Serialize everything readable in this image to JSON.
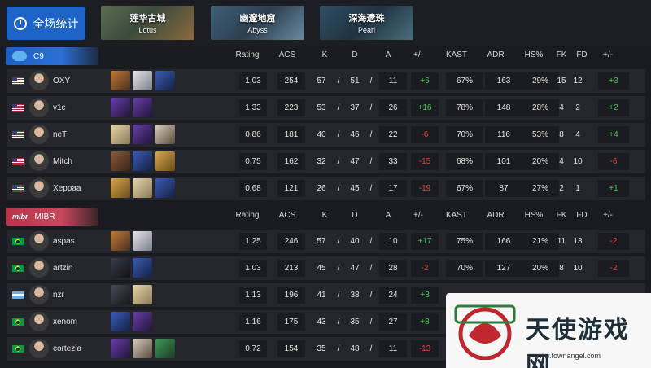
{
  "top_bar": {
    "all_stats_label": "全场统计",
    "maps": [
      {
        "cn": "莲华古城",
        "en": "Lotus"
      },
      {
        "cn": "幽邃地窟",
        "en": "Abyss"
      },
      {
        "cn": "深海遗珠",
        "en": "Pearl"
      }
    ]
  },
  "headers": [
    "Rating",
    "ACS",
    "K",
    "D",
    "A",
    "+/-",
    "KAST",
    "ADR",
    "HS%",
    "FK",
    "FD",
    "+/-"
  ],
  "colors": {
    "accent_blue": "#1e63c8",
    "team_red": "#c8485d",
    "positive": "#3fd14c",
    "negative": "#e5453b"
  },
  "teams": [
    {
      "name": "C9",
      "logo_icon": "cloud9-logo-icon",
      "players": [
        {
          "flag": "us",
          "name": "OXY",
          "agents": [
            "orange-agent-icon",
            "white-agent-icon",
            "blue-agent-icon"
          ],
          "rating": "1.03",
          "acs": "254",
          "k": "57",
          "sep1": "/",
          "d": "51",
          "sep2": "/",
          "a": "11",
          "pm": "+6",
          "kast": "67%",
          "adr": "163",
          "hs": "29%",
          "fk": "15",
          "fd": "12",
          "fkpm": "+3"
        },
        {
          "flag": "us",
          "name": "v1c",
          "agents": [
            "purple-agent-icon",
            "purple-agent-icon"
          ],
          "rating": "1.33",
          "acs": "223",
          "k": "53",
          "sep1": "/",
          "d": "37",
          "sep2": "/",
          "a": "26",
          "pm": "+16",
          "kast": "78%",
          "adr": "148",
          "hs": "28%",
          "fk": "4",
          "fd": "2",
          "fkpm": "+2"
        },
        {
          "flag": "us",
          "name": "neT",
          "agents": [
            "blonde-agent-icon",
            "purple-agent-icon",
            "hat-agent-icon"
          ],
          "rating": "0.86",
          "acs": "181",
          "k": "40",
          "sep1": "/",
          "d": "46",
          "sep2": "/",
          "a": "22",
          "pm": "-6",
          "kast": "70%",
          "adr": "116",
          "hs": "53%",
          "fk": "8",
          "fd": "4",
          "fkpm": "+4"
        },
        {
          "flag": "us",
          "name": "Mitch",
          "agents": [
            "brown-agent-icon",
            "blue-agent-icon",
            "gold-agent-icon"
          ],
          "rating": "0.75",
          "acs": "162",
          "k": "32",
          "sep1": "/",
          "d": "47",
          "sep2": "/",
          "a": "33",
          "pm": "-15",
          "kast": "68%",
          "adr": "101",
          "hs": "20%",
          "fk": "4",
          "fd": "10",
          "fkpm": "-6"
        },
        {
          "flag": "us",
          "name": "Xeppaa",
          "agents": [
            "gold-agent-icon",
            "blonde-agent-icon",
            "blue-agent-icon"
          ],
          "rating": "0.68",
          "acs": "121",
          "k": "26",
          "sep1": "/",
          "d": "45",
          "sep2": "/",
          "a": "17",
          "pm": "-19",
          "kast": "67%",
          "adr": "87",
          "hs": "27%",
          "fk": "2",
          "fd": "1",
          "fkpm": "+1"
        }
      ]
    },
    {
      "name": "MIBR",
      "logo_icon": "mibr-logo-icon",
      "players": [
        {
          "flag": "br",
          "name": "aspas",
          "agents": [
            "orange-agent-icon",
            "white-agent-icon"
          ],
          "rating": "1.25",
          "acs": "246",
          "k": "57",
          "sep1": "/",
          "d": "40",
          "sep2": "/",
          "a": "10",
          "pm": "+17",
          "kast": "75%",
          "adr": "166",
          "hs": "21%",
          "fk": "11",
          "fd": "13",
          "fkpm": "-2"
        },
        {
          "flag": "br",
          "name": "artzin",
          "agents": [
            "masked-agent-icon",
            "blue-agent-icon"
          ],
          "rating": "1.03",
          "acs": "213",
          "k": "45",
          "sep1": "/",
          "d": "47",
          "sep2": "/",
          "a": "28",
          "pm": "-2",
          "kast": "70%",
          "adr": "127",
          "hs": "20%",
          "fk": "8",
          "fd": "10",
          "fkpm": "-2"
        },
        {
          "flag": "ar",
          "name": "nzr",
          "agents": [
            "dark-agent-icon",
            "blonde-agent-icon"
          ],
          "rating": "1.13",
          "acs": "196",
          "k": "41",
          "sep1": "/",
          "d": "38",
          "sep2": "/",
          "a": "24",
          "pm": "+3"
        },
        {
          "flag": "br",
          "name": "xenom",
          "agents": [
            "blue-agent-icon",
            "purple-agent-icon"
          ],
          "rating": "1.16",
          "acs": "175",
          "k": "43",
          "sep1": "/",
          "d": "35",
          "sep2": "/",
          "a": "27",
          "pm": "+8"
        },
        {
          "flag": "br",
          "name": "cortezia",
          "agents": [
            "purple-agent-icon",
            "hat-agent-icon",
            "green-agent-icon"
          ],
          "rating": "0.72",
          "acs": "154",
          "k": "35",
          "sep1": "/",
          "d": "48",
          "sep2": "/",
          "a": "11",
          "pm": "-13"
        }
      ]
    }
  ],
  "watermark": {
    "text": "天使游戏网",
    "url": "www.townangel.com"
  }
}
